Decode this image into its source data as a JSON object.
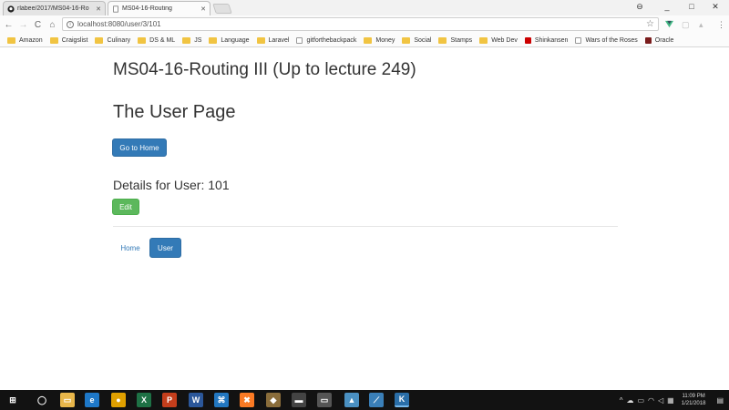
{
  "browser": {
    "tabs": [
      {
        "title": "rlabee/2017/MS04-16-Ro",
        "favicon": "github-icon",
        "close": "✕"
      },
      {
        "title": "MS04-16-Routing",
        "favicon": "page-icon",
        "close": "✕"
      }
    ],
    "window_controls": {
      "profile": "⊖",
      "minimize": "_",
      "maximize": "□",
      "close": "✕"
    },
    "toolbar": {
      "back": "←",
      "forward": "→",
      "reload": "C",
      "home": "⌂"
    },
    "address": {
      "info": "i",
      "url": "localhost:8080/user/3/101",
      "star": "☆"
    },
    "bookmarks": [
      "Amazon",
      "Craigslist",
      "Culinary",
      "DS & ML",
      "JS",
      "Language",
      "Laravel",
      "gitforthebackpack",
      "Money",
      "Social",
      "Stamps",
      "Web Dev",
      "Shinkansen",
      "Wars of the Roses",
      "Oracle"
    ]
  },
  "page": {
    "title": "MS04-16-Routing III (Up to lecture 249)",
    "heading": "The User Page",
    "go_home_label": "Go to Home",
    "details_label": "Details for User: 101",
    "edit_label": "Edit",
    "nav": {
      "home_label": "Home",
      "user_label": "User"
    }
  },
  "taskbar": {
    "apps": [
      {
        "name": "start-button",
        "glyph": "⊞",
        "color": "#121212"
      },
      {
        "name": "search-icon",
        "glyph": "◯",
        "color": "#121212"
      },
      {
        "name": "file-explorer-icon",
        "glyph": "▭",
        "color": "#e8b64a"
      },
      {
        "name": "edge-icon",
        "glyph": "e",
        "color": "#1e78c8"
      },
      {
        "name": "chrome-icon",
        "glyph": "●",
        "color": "#e0a000"
      },
      {
        "name": "excel-icon",
        "glyph": "X",
        "color": "#1e7145"
      },
      {
        "name": "powerpoint-icon",
        "glyph": "P",
        "color": "#c43e1c"
      },
      {
        "name": "word-icon",
        "glyph": "W",
        "color": "#2b579a"
      },
      {
        "name": "vscode-icon",
        "glyph": "⌘",
        "color": "#2277c0"
      },
      {
        "name": "xampp-icon",
        "glyph": "✖",
        "color": "#fb7a24"
      },
      {
        "name": "app-icon",
        "glyph": "◆",
        "color": "#8a6d3b"
      },
      {
        "name": "terminal-icon",
        "glyph": "▬",
        "color": "#444444"
      },
      {
        "name": "console-icon",
        "glyph": "▭",
        "color": "#555555"
      },
      {
        "name": "app2-icon",
        "glyph": "▲",
        "color": "#4a90c2"
      },
      {
        "name": "app3-icon",
        "glyph": "⟋",
        "color": "#3a7fb8"
      },
      {
        "name": "app4-icon",
        "glyph": "K",
        "color": "#2a6ea8"
      },
      {
        "name": "chrome-active-icon",
        "glyph": "●",
        "color": "#e0a000"
      }
    ],
    "clock_time": "11:09 PM",
    "clock_date": "1/21/2018"
  }
}
